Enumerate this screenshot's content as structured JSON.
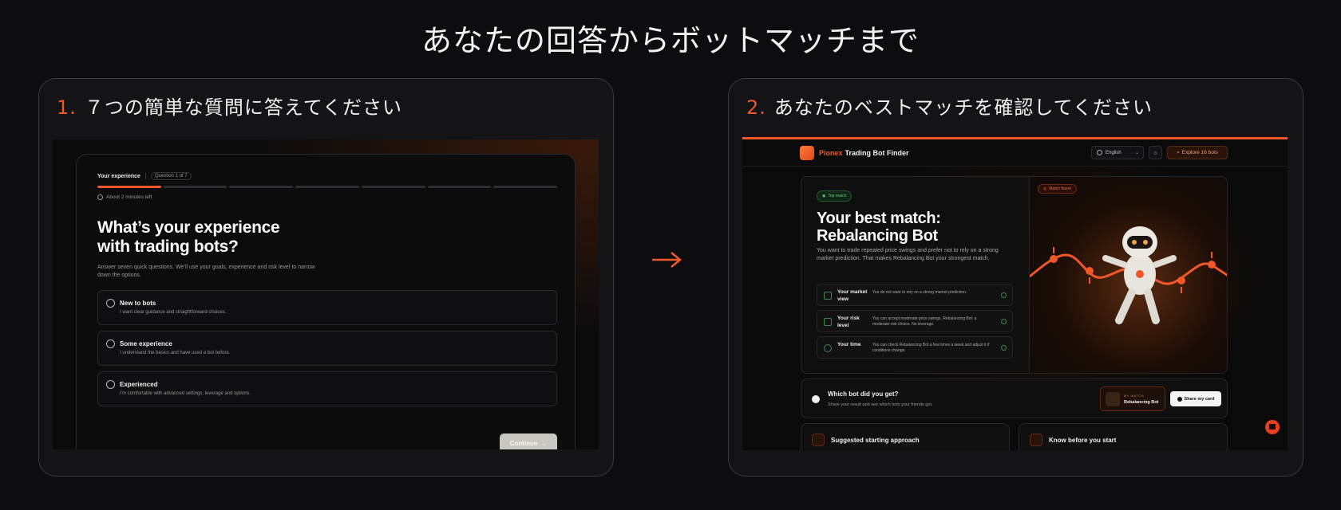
{
  "page": {
    "title": "あなたの回答からボットマッチまで"
  },
  "panels": [
    {
      "number": "1.",
      "heading": "７つの簡単な質問に答えてください"
    },
    {
      "number": "2.",
      "heading": "あなたのベストマッチを確認してください"
    }
  ],
  "quiz": {
    "section": "Your experience",
    "question_counter": "Question 1 of 7",
    "progress": {
      "current": 1,
      "total": 7
    },
    "time_left": "About 2 minutes left",
    "title": "What’s your experience with trading bots?",
    "subtitle": "Answer seven quick questions. We’ll use your goals, experience and risk level to narrow down the options.",
    "options": [
      {
        "label": "New to bots",
        "description": "I want clear guidance and straightforward choices."
      },
      {
        "label": "Some experience",
        "description": "I understand the basics and have used a bot before."
      },
      {
        "label": "Experienced",
        "description": "I’m comfortable with advanced settings, leverage and options."
      }
    ],
    "continue_label": "Continue",
    "continue_arrow": "→"
  },
  "result": {
    "brand_name": "Pionex",
    "brand_suffix": "Trading Bot Finder",
    "language": "English",
    "explore_label": "Explore 16 bots",
    "top_badge": "Top match",
    "found_badge": "Match found",
    "title": "Your best match: Rebalancing Bot",
    "description": "You want to trade repeated price swings and prefer not to rely on a strong market prediction. That makes Rebalancing Bot your strongest match.",
    "reasons": [
      {
        "label": "Your market view",
        "text": "You do not want to rely on a strong market prediction."
      },
      {
        "label": "Your risk level",
        "text": "You can accept moderate price swings. Rebalancing Bot: a moderate-risk choice. No leverage."
      },
      {
        "label": "Your time",
        "text": "You can check Rebalancing Bot a few times a week and adjust it if conditions change."
      }
    ],
    "share": {
      "title": "Which bot did you get?",
      "subtitle": "Share your result and see which bots your friends get.",
      "my_match_label": "MY MATCH",
      "my_match_name": "Rebalancing Bot",
      "button_label": "Share my card"
    },
    "cards": [
      {
        "title": "Suggested starting approach"
      },
      {
        "title": "Know before you start"
      }
    ]
  },
  "colors": {
    "accent": "#f0582a",
    "background": "#0d0d10",
    "panel": "#141417",
    "success": "#66d07a"
  }
}
